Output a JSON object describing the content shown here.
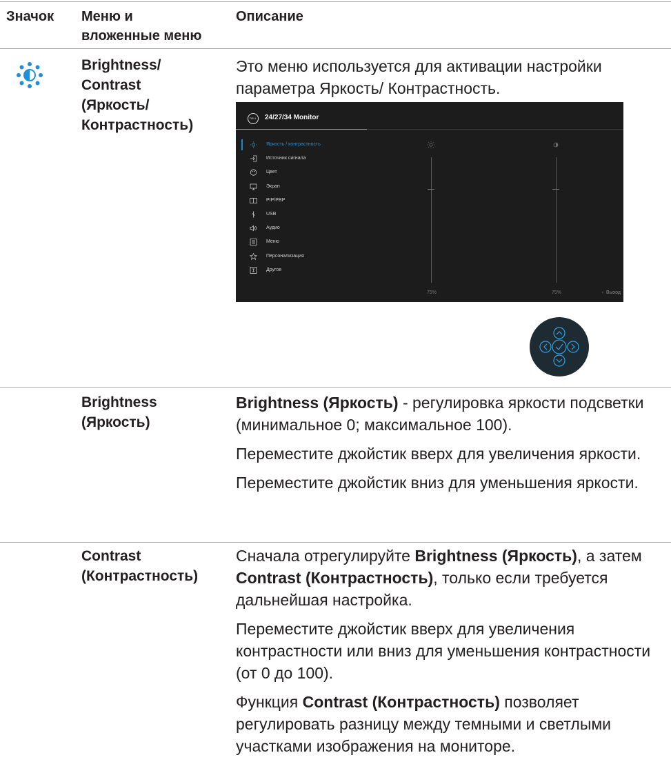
{
  "header": {
    "col_icon": "Значок",
    "col_menu_line1": "Меню и",
    "col_menu_line2": "вложенные меню",
    "col_desc": "Описание"
  },
  "row1": {
    "icon": "brightness-contrast-icon",
    "menu_lines": [
      "Brightness/",
      "Contrast",
      "(Яркость/",
      "Контрастность)"
    ],
    "desc": "Это меню используется для активации настройки параметра Яркость/ Контрастность."
  },
  "osd": {
    "logo": "DELL",
    "title": "24/27/34 Monitor",
    "items": [
      {
        "label": "Яркость / контрастность",
        "icon": "sun-icon"
      },
      {
        "label": "Источник сигнала",
        "icon": "input-icon"
      },
      {
        "label": "Цвет",
        "icon": "palette-icon"
      },
      {
        "label": "Экран",
        "icon": "display-icon"
      },
      {
        "label": "PIP/PBP",
        "icon": "pip-icon"
      },
      {
        "label": "USB",
        "icon": "usb-icon"
      },
      {
        "label": "Аудио",
        "icon": "speaker-icon"
      },
      {
        "label": "Меню",
        "icon": "menu-icon"
      },
      {
        "label": "Персонализация",
        "icon": "star-icon"
      },
      {
        "label": "Другое",
        "icon": "other-icon"
      }
    ],
    "brightness_pct": "75%",
    "contrast_pct": "75%",
    "brightness_value": 0.75,
    "contrast_value": 0.75,
    "exit_label": "Выход",
    "accent": "#2b8fd6"
  },
  "row2": {
    "menu_line1": "Brightness",
    "menu_line2": "(Яркость)",
    "p1_bold": "Brightness (Яркость)",
    "p1_rest": " - регулировка яркости подсветки  (минимальное 0; максимальное 100).",
    "p2": "Переместите джойстик вверх для увеличения яркости.",
    "p3": "Переместите джойстик вниз для уменьшения яркости."
  },
  "row3": {
    "menu_line1": "Contrast",
    "menu_line2": "(Контрастность)",
    "p1_a": "Сначала отрегулируйте ",
    "p1_b1": "Brightness (Яркость)",
    "p1_c": ", а затем ",
    "p1_b2": "Contrast (Контрастность)",
    "p1_d": ", только если требуется дальнейшая настройка.",
    "p2": "Переместите джойстик вверх для увеличения контрастности или вниз для уменьшения контрастности (от 0 до 100).",
    "p3_a": "Функция ",
    "p3_b": "Contrast (Контрастность)",
    "p3_c": " позволяет регулировать разницу между темными и светлыми участками изображения на мониторе."
  }
}
